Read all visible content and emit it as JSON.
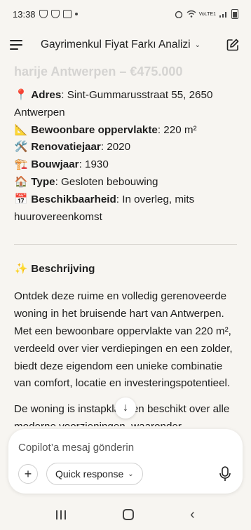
{
  "status_bar": {
    "time": "13:38",
    "network_label": "VoLTE1",
    "signal": "LTE"
  },
  "header": {
    "title": "Gayrimenkul Fiyat Farkı Analizi",
    "menu_icon": "hamburger-icon",
    "edit_icon": "edit-icon"
  },
  "article": {
    "faded_title": "harije Antwerpen – €475.000",
    "properties": [
      {
        "emoji": "📍",
        "label": "Adres",
        "value": ": Sint-Gummarusstraat 55, 2650 Antwerpen"
      },
      {
        "emoji": "📐",
        "label": "Bewoonbare oppervlakte",
        "value": ": 220 m²"
      },
      {
        "emoji": "🛠️",
        "label": "Renovatiejaar",
        "value": ": 2020"
      },
      {
        "emoji": "🏗️",
        "label": "Bouwjaar",
        "value": ": 1930"
      },
      {
        "emoji": "🏠",
        "label": "Type",
        "value": ": Gesloten bebouwing"
      },
      {
        "emoji": "📅",
        "label": "Beschikbaarheid",
        "value": ": In overleg, mits huurovereenkomst"
      }
    ],
    "section_emoji": "✨",
    "section_title": "Beschrijving",
    "paragraph1": "Ontdek deze ruime en volledig gerenoveerde woning in het bruisende hart van Antwerpen. Met een bewoonbare oppervlakte van 220 m², verdeeld over vier verdiepingen en een zolder, biedt deze eigendom een unieke combinatie van comfort, locatie en investeringspotentieel.",
    "paragraph2": "De woning is instapklaar en beschikt over alle moderne voorzieningen, waaronder"
  },
  "composer": {
    "placeholder": "Copilot’a mesaj gönderin",
    "quick_response": "Quick response",
    "plus_label": "+"
  }
}
